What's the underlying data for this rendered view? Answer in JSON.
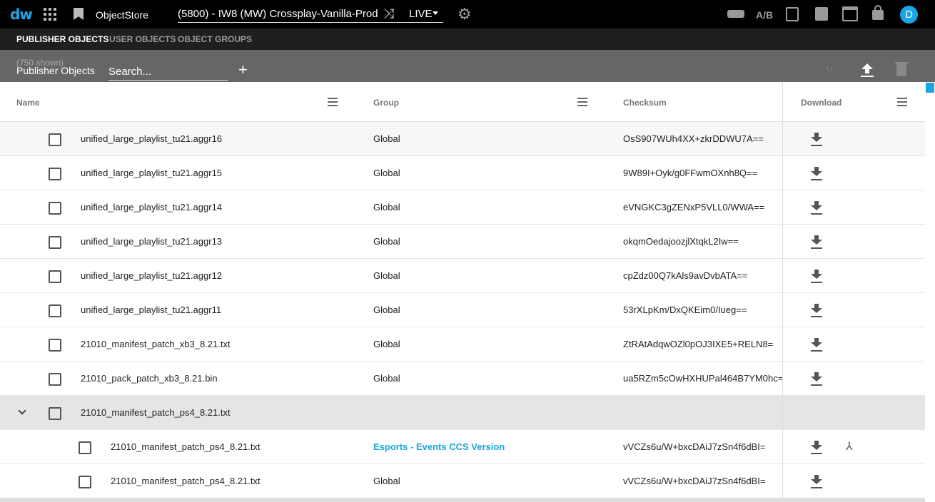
{
  "topbar": {
    "logo": "dw",
    "app_name": "ObjectStore",
    "environment": "(5800) - IW8 (MW) Crossplay-Vanilla-Prod",
    "mode": "LIVE",
    "ab_label": "A/B",
    "user_initial": "D",
    "icons": [
      "apps-icon",
      "bookmark-icon",
      "shuffle-icon",
      "gear-icon",
      "gamepad-icon",
      "ab-icon",
      "document-icon",
      "chart-icon",
      "calendar-icon",
      "lock-icon"
    ]
  },
  "subnav": {
    "tabs": [
      {
        "label": "PUBLISHER OBJECTS",
        "active": true
      },
      {
        "label": "USER OBJECTS",
        "active": false
      },
      {
        "label": "OBJECT GROUPS",
        "active": false
      }
    ]
  },
  "toolbar": {
    "shown": "(750 shown)",
    "title": "Publisher Objects",
    "search_placeholder": "Search...",
    "add": "+"
  },
  "columns": {
    "name": "Name",
    "group": "Group",
    "checksum": "Checksum",
    "download": "Download"
  },
  "rows": [
    {
      "name": "unified_large_playlist_tu21.aggr16",
      "group": "Global",
      "checksum": "OsS907WUh4XX+zkrDDWU7A=="
    },
    {
      "name": "unified_large_playlist_tu21.aggr15",
      "group": "Global",
      "checksum": "9W89I+Oyk/g0FFwmOXnh8Q=="
    },
    {
      "name": "unified_large_playlist_tu21.aggr14",
      "group": "Global",
      "checksum": "eVNGKC3gZENxP5VLL0/WWA=="
    },
    {
      "name": "unified_large_playlist_tu21.aggr13",
      "group": "Global",
      "checksum": "okqmOedajoozjlXtqkL2Iw=="
    },
    {
      "name": "unified_large_playlist_tu21.aggr12",
      "group": "Global",
      "checksum": "cpZdz00Q7kAls9avDvbATA=="
    },
    {
      "name": "unified_large_playlist_tu21.aggr11",
      "group": "Global",
      "checksum": "53rXLpKm/DxQKEim0/Iueg=="
    },
    {
      "name": "21010_manifest_patch_xb3_8.21.txt",
      "group": "Global",
      "checksum": "ZtRAtAdqwOZl0pOJ3IXE5+RELN8="
    },
    {
      "name": "21010_pack_patch_xb3_8.21.bin",
      "group": "Global",
      "checksum": "ua5RZm5cOwHXHUPal464B7YM0hc="
    }
  ],
  "group_row": {
    "name": "21010_manifest_patch_ps4_8.21.txt"
  },
  "child_rows": [
    {
      "name": "21010_manifest_patch_ps4_8.21.txt",
      "group": "Esports - Events CCS Version",
      "checksum": "vVCZs6u/W+bxcDAiJ7zSn4f6dBI="
    },
    {
      "name": "21010_manifest_patch_ps4_8.21.txt",
      "group": "Global",
      "checksum": "vVCZs6u/W+bxcDAiJ7zSn4f6dBI="
    }
  ],
  "colors": {
    "accent": "#19a6e6",
    "topbar": "#000000",
    "subnav": "#1f1f1f",
    "toolbar": "#666666",
    "group_row": "#e5e5e5",
    "link": "#1aa7e0"
  }
}
